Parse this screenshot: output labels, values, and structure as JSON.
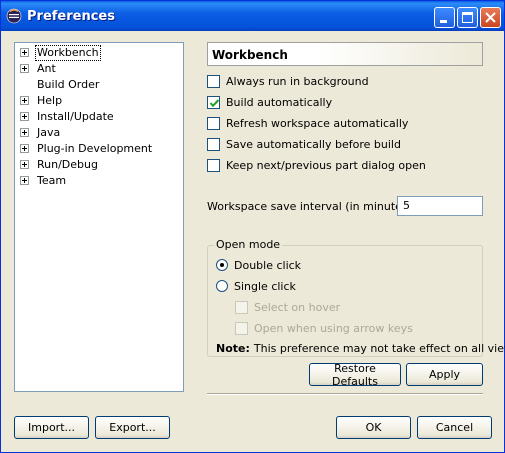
{
  "window": {
    "title": "Preferences",
    "colors": {
      "titlebar": "#0a5fe8",
      "face": "#ece9d8",
      "close": "#c9461f"
    }
  },
  "tree": {
    "items": [
      {
        "label": "Workbench",
        "expandable": true,
        "selected": true
      },
      {
        "label": "Ant",
        "expandable": true,
        "selected": false
      },
      {
        "label": "Build Order",
        "expandable": false,
        "selected": false
      },
      {
        "label": "Help",
        "expandable": true,
        "selected": false
      },
      {
        "label": "Install/Update",
        "expandable": true,
        "selected": false
      },
      {
        "label": "Java",
        "expandable": true,
        "selected": false
      },
      {
        "label": "Plug-in Development",
        "expandable": true,
        "selected": false
      },
      {
        "label": "Run/Debug",
        "expandable": true,
        "selected": false
      },
      {
        "label": "Team",
        "expandable": true,
        "selected": false
      }
    ]
  },
  "page": {
    "title": "Workbench",
    "options": [
      {
        "label": "Always run in background",
        "checked": false
      },
      {
        "label": "Build automatically",
        "checked": true
      },
      {
        "label": "Refresh workspace automatically",
        "checked": false
      },
      {
        "label": "Save automatically before build",
        "checked": false
      },
      {
        "label": "Keep next/previous part dialog open",
        "checked": false
      }
    ],
    "save_interval_label": "Workspace save interval (in minutes):",
    "save_interval_value": "5",
    "open_mode": {
      "title": "Open mode",
      "double_click": "Double click",
      "single_click": "Single click",
      "selected": "double_click",
      "select_on_hover": "Select on hover",
      "open_arrow_keys": "Open when using arrow keys",
      "note_label": "Note:",
      "note_text": "This preference may not take effect on all views"
    },
    "restore_defaults": "Restore Defaults",
    "apply": "Apply"
  },
  "footer": {
    "import": "Import...",
    "export": "Export...",
    "ok": "OK",
    "cancel": "Cancel"
  },
  "icons": {
    "app": "eclipse-icon",
    "minimize": "minimize-icon",
    "maximize": "maximize-icon",
    "close": "close-icon",
    "expand": "plus-expander-icon",
    "check": "checkmark-icon"
  }
}
